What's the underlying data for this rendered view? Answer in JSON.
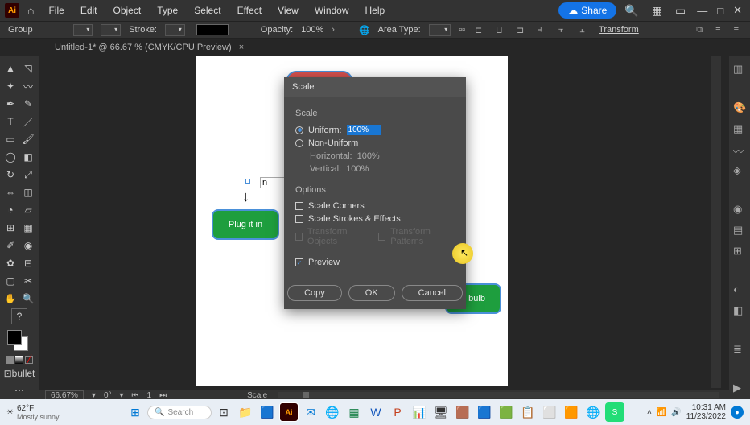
{
  "menubar": {
    "items": [
      "File",
      "Edit",
      "Object",
      "Type",
      "Select",
      "Effect",
      "View",
      "Window",
      "Help"
    ],
    "share": "Share"
  },
  "ctrlbar": {
    "tool_label": "Group",
    "stroke_label": "Stroke:",
    "opacity_label": "Opacity:",
    "opacity_value": "100%",
    "area_type": "Area Type:",
    "transform": "Transform"
  },
  "tab": {
    "label": "Untitled-1* @ 66.67 % (CMYK/CPU Preview)"
  },
  "canvas": {
    "plug_label": "Plug it in",
    "bulb_label": "e bulb",
    "note_label": "n"
  },
  "dialog": {
    "title": "Scale",
    "scale_section": "Scale",
    "uniform": "Uniform:",
    "uniform_val": "100%",
    "non_uniform": "Non-Uniform",
    "horizontal": "Horizontal:",
    "horizontal_val": "100%",
    "vertical": "Vertical:",
    "vertical_val": "100%",
    "options_section": "Options",
    "scale_corners": "Scale Corners",
    "scale_strokes": "Scale Strokes & Effects",
    "transform_obj": "Transform Objects",
    "transform_pat": "Transform Patterns",
    "preview": "Preview",
    "copy": "Copy",
    "ok": "OK",
    "cancel": "Cancel"
  },
  "statusbar": {
    "zoom": "66.67%",
    "rotate": "0°",
    "page": "1",
    "tool": "Scale"
  },
  "taskbar": {
    "temp": "62°F",
    "cond": "Mostly sunny",
    "search": "Search",
    "time": "10:31 AM",
    "date": "11/23/2022"
  }
}
